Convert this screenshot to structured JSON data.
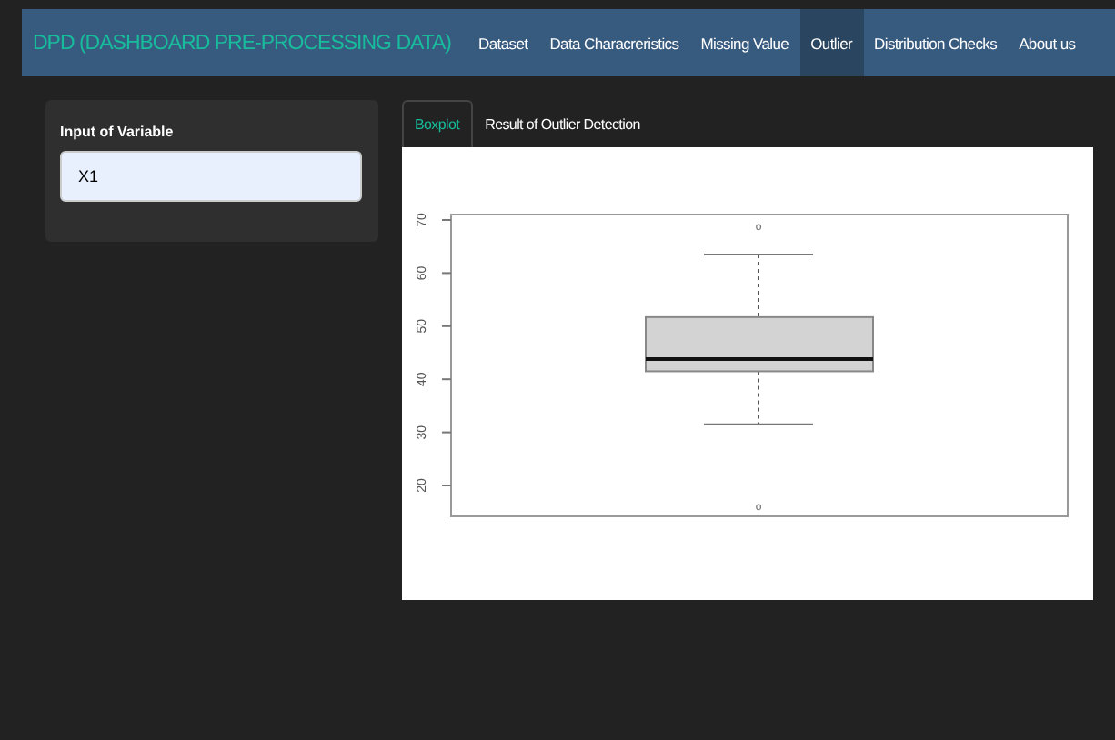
{
  "navbar": {
    "brand": "DPD (DASHBOARD PRE-PROCESSING DATA)",
    "items": [
      {
        "label": "Dataset",
        "selected": false
      },
      {
        "label": "Data Characreristics",
        "selected": false
      },
      {
        "label": "Missing Value",
        "selected": false
      },
      {
        "label": "Outlier",
        "selected": true
      },
      {
        "label": "Distribution Checks",
        "selected": false
      },
      {
        "label": "About us",
        "selected": false
      }
    ]
  },
  "sidebar": {
    "label": "Input of Variable",
    "value": "X1"
  },
  "tabs": [
    {
      "label": "Boxplot",
      "selected": true
    },
    {
      "label": "Result of Outlier Detection",
      "selected": false
    }
  ],
  "boxplot": {
    "y_tick_labels": [
      "20",
      "30",
      "40",
      "50",
      "60",
      "70"
    ],
    "outlier_marks": [
      "o",
      "o"
    ]
  }
}
